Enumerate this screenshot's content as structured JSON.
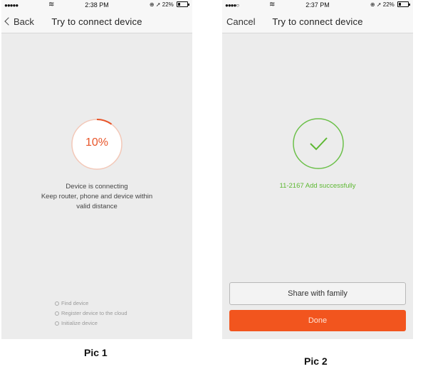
{
  "pic1": {
    "status": {
      "signal": "●●●●●",
      "wifi": "≋",
      "time": "2:38 PM",
      "battery": "22%"
    },
    "nav": {
      "back_label": "Back",
      "title": "Try to connect device"
    },
    "progress": {
      "value": 0.1,
      "label": "10%"
    },
    "message": [
      "Device is connecting",
      "Keep router, phone and device within",
      "valid distance"
    ],
    "steps": [
      "Find device",
      "Register device to the cloud",
      "Initialize device"
    ]
  },
  "pic2": {
    "status": {
      "signal": "●●●●○",
      "wifi": "≋",
      "time": "2:37 PM",
      "battery": "22%"
    },
    "nav": {
      "cancel_label": "Cancel",
      "title": "Try to connect device"
    },
    "success_message": "11-2167 Add successfully",
    "share_label": "Share with family",
    "done_label": "Done"
  },
  "captions": {
    "pic1": "Pic 1",
    "pic2": "Pic 2"
  },
  "colors": {
    "accent_orange": "#e8552a",
    "success_green": "#5db832",
    "done_button": "#f2551e"
  }
}
